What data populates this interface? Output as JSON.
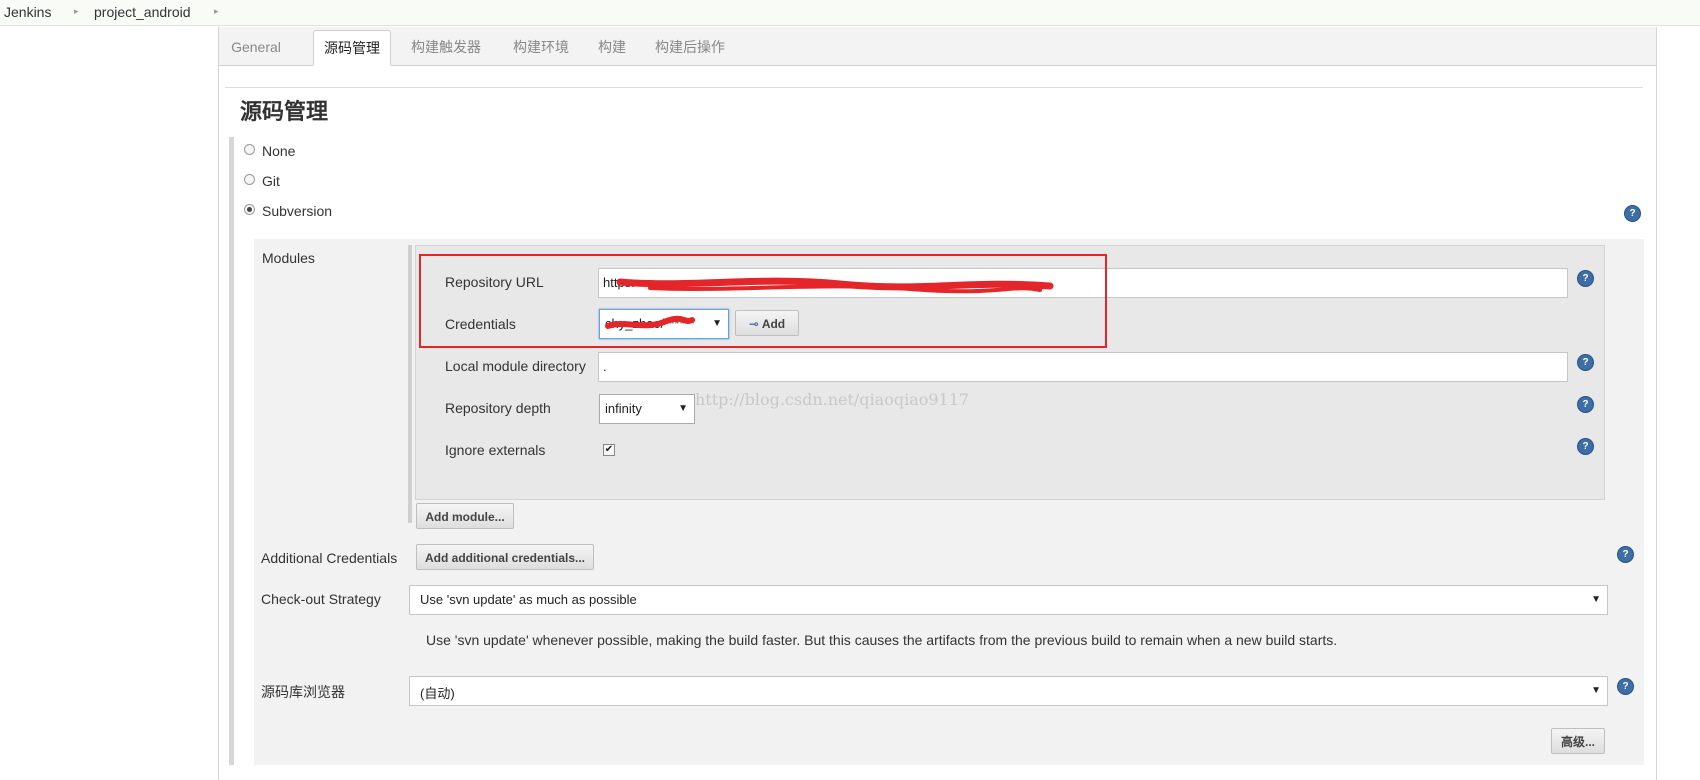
{
  "breadcrumb": {
    "items": [
      "Jenkins",
      "project_android"
    ]
  },
  "tabs": [
    {
      "label": "General",
      "active": false
    },
    {
      "label": "源码管理",
      "active": true
    },
    {
      "label": "构建触发器",
      "active": false
    },
    {
      "label": "构建环境",
      "active": false
    },
    {
      "label": "构建",
      "active": false
    },
    {
      "label": "构建后操作",
      "active": false
    }
  ],
  "section": {
    "title": "源码管理"
  },
  "scm_options": [
    {
      "label": "None",
      "selected": false
    },
    {
      "label": "Git",
      "selected": false
    },
    {
      "label": "Subversion",
      "selected": true
    }
  ],
  "modules": {
    "label": "Modules",
    "repository_url": {
      "label": "Repository URL",
      "value": "https:"
    },
    "credentials": {
      "label": "Credentials",
      "value": "chy_zhao/******",
      "add_button": "Add"
    },
    "local_dir": {
      "label": "Local module directory",
      "value": "."
    },
    "depth": {
      "label": "Repository depth",
      "value": "infinity"
    },
    "ignore_externals": {
      "label": "Ignore externals",
      "checked": true
    },
    "add_module_button": "Add module..."
  },
  "additional_credentials": {
    "label": "Additional Credentials",
    "button": "Add additional credentials..."
  },
  "checkout": {
    "label": "Check-out Strategy",
    "value": "Use 'svn update' as much as possible",
    "description": "Use 'svn update' whenever possible, making the build faster. But this causes the artifacts from the previous build to remain when a new build starts."
  },
  "browser": {
    "label": "源码库浏览器",
    "value": "(自动)"
  },
  "advanced_button": "高级...",
  "watermark": "http://blog.csdn.net/qiaoqiao9117",
  "colors": {
    "help_icon": "#3d6ea6",
    "annotation_red": "#e4262b",
    "breadcrumb_bg": "#f9fbf6"
  }
}
